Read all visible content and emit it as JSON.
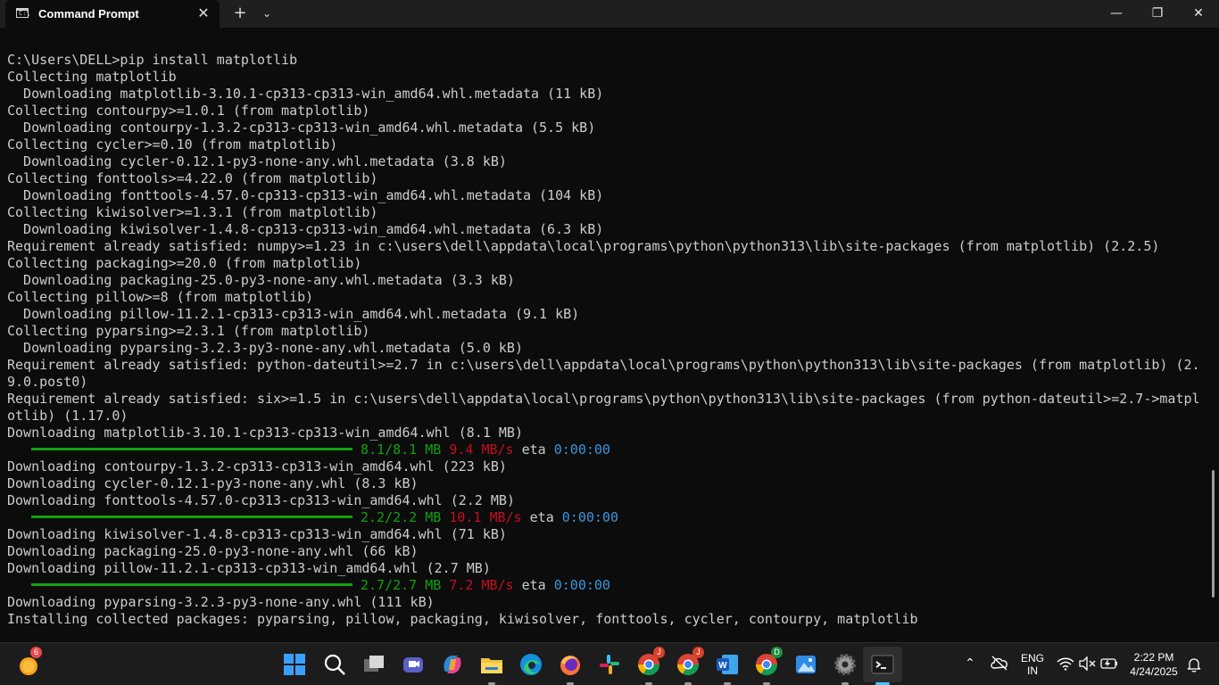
{
  "window": {
    "tab_title": "Command Prompt",
    "tab_icon_glyph": "C:\\",
    "close_tab_glyph": "✕",
    "new_tab_glyph": "+",
    "dropdown_glyph": "⌄",
    "minimize_glyph": "—",
    "maximize_glyph": "❐",
    "close_glyph": "✕"
  },
  "terminal": {
    "lines": [
      {
        "segments": [
          {
            "text": "C:\\Users\\DELL>pip install matplotlib"
          }
        ]
      },
      {
        "segments": [
          {
            "text": "Collecting matplotlib"
          }
        ]
      },
      {
        "segments": [
          {
            "text": "  Downloading matplotlib-3.10.1-cp313-cp313-win_amd64.whl.metadata (11 kB)"
          }
        ]
      },
      {
        "segments": [
          {
            "text": "Collecting contourpy>=1.0.1 (from matplotlib)"
          }
        ]
      },
      {
        "segments": [
          {
            "text": "  Downloading contourpy-1.3.2-cp313-cp313-win_amd64.whl.metadata (5.5 kB)"
          }
        ]
      },
      {
        "segments": [
          {
            "text": "Collecting cycler>=0.10 (from matplotlib)"
          }
        ]
      },
      {
        "segments": [
          {
            "text": "  Downloading cycler-0.12.1-py3-none-any.whl.metadata (3.8 kB)"
          }
        ]
      },
      {
        "segments": [
          {
            "text": "Collecting fonttools>=4.22.0 (from matplotlib)"
          }
        ]
      },
      {
        "segments": [
          {
            "text": "  Downloading fonttools-4.57.0-cp313-cp313-win_amd64.whl.metadata (104 kB)"
          }
        ]
      },
      {
        "segments": [
          {
            "text": "Collecting kiwisolver>=1.3.1 (from matplotlib)"
          }
        ]
      },
      {
        "segments": [
          {
            "text": "  Downloading kiwisolver-1.4.8-cp313-cp313-win_amd64.whl.metadata (6.3 kB)"
          }
        ]
      },
      {
        "segments": [
          {
            "text": "Requirement already satisfied: numpy>=1.23 in c:\\users\\dell\\appdata\\local\\programs\\python\\python313\\lib\\site-packages (from matplotlib) (2.2.5)"
          }
        ]
      },
      {
        "segments": [
          {
            "text": "Collecting packaging>=20.0 (from matplotlib)"
          }
        ]
      },
      {
        "segments": [
          {
            "text": "  Downloading packaging-25.0-py3-none-any.whl.metadata (3.3 kB)"
          }
        ]
      },
      {
        "segments": [
          {
            "text": "Collecting pillow>=8 (from matplotlib)"
          }
        ]
      },
      {
        "segments": [
          {
            "text": "  Downloading pillow-11.2.1-cp313-cp313-win_amd64.whl.metadata (9.1 kB)"
          }
        ]
      },
      {
        "segments": [
          {
            "text": "Collecting pyparsing>=2.3.1 (from matplotlib)"
          }
        ]
      },
      {
        "segments": [
          {
            "text": "  Downloading pyparsing-3.2.3-py3-none-any.whl.metadata (5.0 kB)"
          }
        ]
      },
      {
        "segments": [
          {
            "text": "Requirement already satisfied: python-dateutil>=2.7 in c:\\users\\dell\\appdata\\local\\programs\\python\\python313\\lib\\site-packages (from matplotlib) (2."
          }
        ]
      },
      {
        "segments": [
          {
            "text": "9.0.post0)"
          }
        ]
      },
      {
        "segments": [
          {
            "text": "Requirement already satisfied: six>=1.5 in c:\\users\\dell\\appdata\\local\\programs\\python\\python313\\lib\\site-packages (from python-dateutil>=2.7->matpl"
          }
        ]
      },
      {
        "segments": [
          {
            "text": "otlib) (1.17.0)"
          }
        ]
      },
      {
        "segments": [
          {
            "text": "Downloading matplotlib-3.10.1-cp313-cp313-win_amd64.whl (8.1 MB)"
          }
        ]
      },
      {
        "progress": 1.0,
        "segments": [
          {
            "text": "8.1/8.1 MB",
            "color": "green"
          },
          {
            "text": " "
          },
          {
            "text": "9.4 MB/s",
            "color": "red"
          },
          {
            "text": " eta "
          },
          {
            "text": "0:00:00",
            "color": "blue"
          }
        ]
      },
      {
        "segments": [
          {
            "text": "Downloading contourpy-1.3.2-cp313-cp313-win_amd64.whl (223 kB)"
          }
        ]
      },
      {
        "segments": [
          {
            "text": "Downloading cycler-0.12.1-py3-none-any.whl (8.3 kB)"
          }
        ]
      },
      {
        "segments": [
          {
            "text": "Downloading fonttools-4.57.0-cp313-cp313-win_amd64.whl (2.2 MB)"
          }
        ]
      },
      {
        "progress": 1.0,
        "segments": [
          {
            "text": "2.2/2.2 MB",
            "color": "green"
          },
          {
            "text": " "
          },
          {
            "text": "10.1 MB/s",
            "color": "red"
          },
          {
            "text": " eta "
          },
          {
            "text": "0:00:00",
            "color": "blue"
          }
        ]
      },
      {
        "segments": [
          {
            "text": "Downloading kiwisolver-1.4.8-cp313-cp313-win_amd64.whl (71 kB)"
          }
        ]
      },
      {
        "segments": [
          {
            "text": "Downloading packaging-25.0-py3-none-any.whl (66 kB)"
          }
        ]
      },
      {
        "segments": [
          {
            "text": "Downloading pillow-11.2.1-cp313-cp313-win_amd64.whl (2.7 MB)"
          }
        ]
      },
      {
        "progress": 1.0,
        "segments": [
          {
            "text": "2.7/2.7 MB",
            "color": "green"
          },
          {
            "text": " "
          },
          {
            "text": "7.2 MB/s",
            "color": "red"
          },
          {
            "text": " eta "
          },
          {
            "text": "0:00:00",
            "color": "blue"
          }
        ]
      },
      {
        "segments": [
          {
            "text": "Downloading pyparsing-3.2.3-py3-none-any.whl (111 kB)"
          }
        ]
      },
      {
        "segments": [
          {
            "text": "Installing collected packages: pyparsing, pillow, packaging, kiwisolver, fonttools, cycler, contourpy, matplotlib"
          }
        ]
      }
    ]
  },
  "taskbar": {
    "weather_badge": "6",
    "chrome_badge_1": "J",
    "chrome_badge_2": "J",
    "chrome_badge_3": "D",
    "language_line1": "ENG",
    "language_line2": "IN",
    "time": "2:22 PM",
    "date": "4/24/2025",
    "icons": [
      "weather-icon",
      "start-icon",
      "search-icon",
      "task-view-icon",
      "meet-icon",
      "copilot-icon",
      "file-explorer-icon",
      "edge-icon",
      "firefox-icon",
      "slack-icon",
      "chrome-icon",
      "chrome-icon",
      "word-icon",
      "chrome-icon",
      "photos-icon",
      "settings-icon",
      "terminal-icon"
    ]
  },
  "colors": {
    "green": "#13a10e",
    "red": "#c50f1f",
    "blue": "#3a96dd",
    "text": "#cccccc"
  }
}
